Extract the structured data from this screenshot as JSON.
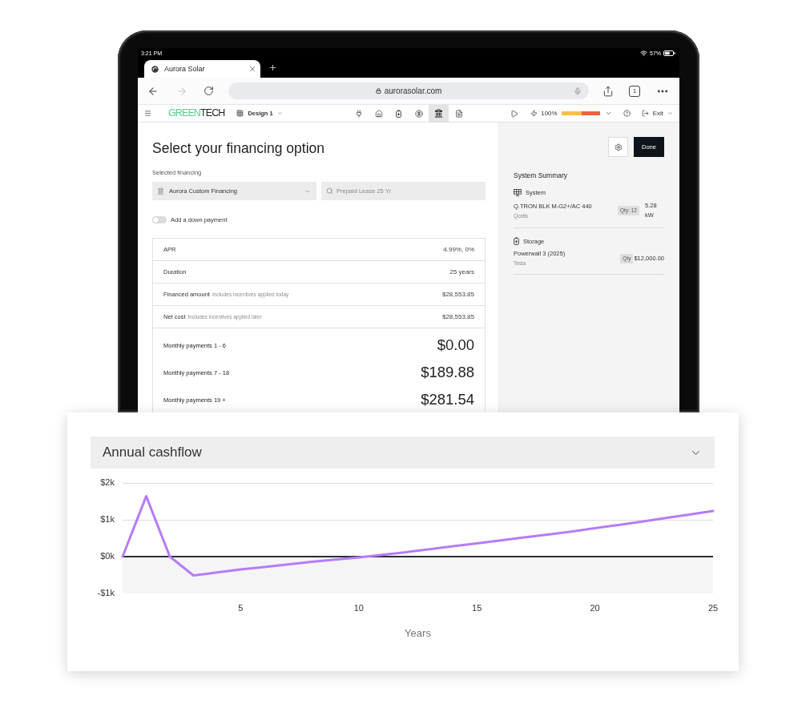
{
  "status_bar": {
    "time": "3:21 PM",
    "battery": "57%"
  },
  "browser": {
    "tabs": [
      {
        "title": "Aurora Solar",
        "selected": true
      }
    ],
    "back_disabled": false,
    "forward_disabled": true,
    "url": "aurorasolar.com",
    "tab_count": "1"
  },
  "toolbar": {
    "logo_parts": [
      "GREEN",
      "TECH"
    ],
    "design": "Design 1",
    "modes": [
      {
        "selected": false
      },
      {
        "selected": false
      },
      {
        "selected": false
      },
      {
        "selected": false
      },
      {
        "selected": true
      },
      {
        "selected": false
      }
    ],
    "offset": {
      "reading": "100%",
      "level": 1
    },
    "exit": "Exit"
  },
  "financing": {
    "title": "Select your financing option",
    "field_label": "Selected financing",
    "provider": "Aurora Custom Financing",
    "plan_search": {
      "placeholder": "Prepaid Lease 25 Yr"
    },
    "down_payment": {
      "label": "Add a down payment",
      "on": false
    },
    "details": [
      {
        "label": "APR",
        "value": "4.99%, 0%"
      },
      {
        "label": "Duration",
        "value": "25 years"
      },
      {
        "label": "Financed amount",
        "note": "Includes incentives applied today",
        "value": "$28,553.85"
      },
      {
        "label": "Net cost",
        "note": "Includes incentives applied later",
        "value": "$28,553.85"
      }
    ],
    "payments": [
      {
        "label": "Monthly payments 1 - 6",
        "value": "$0.00"
      },
      {
        "label": "Monthly payments 7 - 18",
        "value": "$189.88"
      },
      {
        "label": "Monthly payments 19 +",
        "value": "$281.54"
      }
    ]
  },
  "summary": {
    "done": "Done",
    "title": "System Summary",
    "sections": [
      {
        "kind": "system",
        "heading": "System",
        "item": "Q.TRON BLK M-G2+/AC 440",
        "maker": "Qcells",
        "qty": "Qty: 12",
        "amount": "5.28 kW"
      },
      {
        "kind": "storage",
        "heading": "Storage",
        "item": "Powerwall 3 (2025)",
        "maker": "Tesla",
        "qty": "Qty",
        "amount": "$12,000.00"
      }
    ]
  },
  "cashflow": {
    "chart_data": {
      "type": "line",
      "title": "Annual cashflow",
      "xlabel": "Years",
      "x": [
        0,
        1,
        2,
        3,
        4,
        5,
        6,
        7,
        8,
        9,
        10,
        11,
        12,
        13,
        14,
        15,
        16,
        17,
        18,
        19,
        20,
        21,
        22,
        23,
        24,
        25
      ],
      "values": [
        0,
        1640,
        0,
        -510,
        -430,
        -350,
        -280,
        -210,
        -140,
        -80,
        -20,
        50,
        120,
        200,
        280,
        360,
        440,
        520,
        600,
        680,
        770,
        860,
        950,
        1050,
        1140,
        1240
      ],
      "xlim": [
        0,
        25
      ],
      "ylim": [
        -1000,
        2000
      ],
      "xticks": [
        5,
        10,
        15,
        20,
        25
      ],
      "yticks": [
        {
          "value": -1000,
          "label": "-$1k"
        },
        {
          "value": 0,
          "label": "$0k"
        },
        {
          "value": 1000,
          "label": "$1k"
        },
        {
          "value": 2000,
          "label": "$2k"
        }
      ],
      "ref_lines": [
        {
          "axis": "y",
          "value": 2000
        },
        {
          "axis": "y",
          "value": 1000
        }
      ],
      "bands": [
        {
          "axis": "y",
          "from": -1000,
          "to": 0
        }
      ]
    }
  }
}
